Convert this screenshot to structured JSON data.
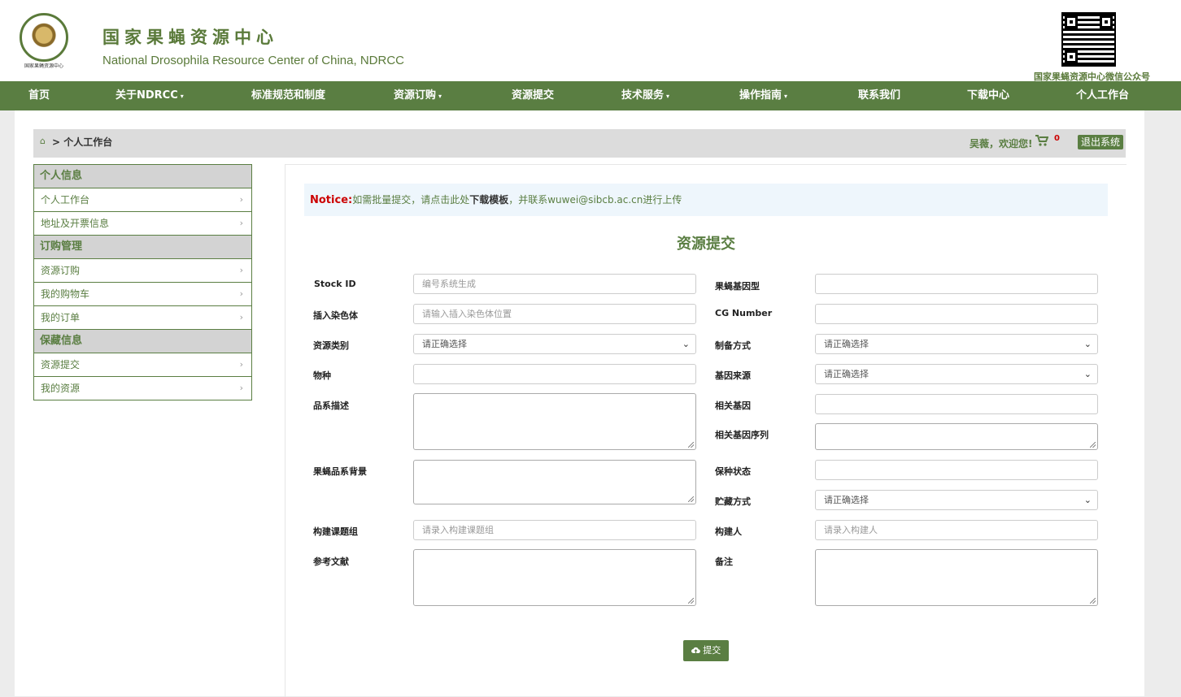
{
  "header": {
    "title_cn": "国家果蝇资源中心",
    "title_en": "National Drosophila Resource Center of China, NDRCC",
    "logo_caption": "国家果蝇资源中心",
    "qr_caption": "国家果蝇资源中心微信公众号"
  },
  "nav": {
    "items": [
      {
        "label": "首页"
      },
      {
        "label": "关于NDRCC",
        "dropdown": true
      },
      {
        "label": "标准规范和制度"
      },
      {
        "label": "资源订购",
        "dropdown": true
      },
      {
        "label": "资源提交"
      },
      {
        "label": "技术服务",
        "dropdown": true
      },
      {
        "label": "操作指南",
        "dropdown": true
      },
      {
        "label": "联系我们"
      },
      {
        "label": "下载中心"
      },
      {
        "label": "个人工作台"
      }
    ],
    "caret": "▾"
  },
  "breadcrumb": {
    "home_icon": "home-icon",
    "separator_text": ">",
    "current": "个人工作台",
    "welcome": "吴薇，欢迎您!",
    "cart_count": "0",
    "logout": "退出系统"
  },
  "sidebar": {
    "groups": [
      {
        "title": "个人信息",
        "items": [
          "个人工作台",
          "地址及开票信息"
        ]
      },
      {
        "title": "订购管理",
        "items": [
          "资源订购",
          "我的购物车",
          "我的订单"
        ]
      },
      {
        "title": "保藏信息",
        "items": [
          "资源提交",
          "我的资源"
        ]
      }
    ],
    "chevron": "›"
  },
  "notice": {
    "label": "Notice:",
    "text1": "如需批量提交，请点击此处",
    "link": "下载模板",
    "text2": "，并联系wuwei@sibcb.ac.cn进行上传"
  },
  "form": {
    "title": "资源提交",
    "stock_id": {
      "label": "Stock ID",
      "placeholder": "编号系统生成"
    },
    "genotype": {
      "label": "果蝇基因型",
      "value": ""
    },
    "chromosome": {
      "label": "插入染色体",
      "placeholder": "请输入插入染色体位置"
    },
    "cg_number": {
      "label": "CG Number",
      "value": ""
    },
    "category": {
      "label": "资源类别",
      "selected": "请正确选择"
    },
    "prep_method": {
      "label": "制备方式",
      "selected": "请正确选择"
    },
    "species": {
      "label": "物种",
      "value": ""
    },
    "gene_source": {
      "label": "基因来源",
      "selected": "请正确选择"
    },
    "strain_desc": {
      "label": "品系描述"
    },
    "related_gene": {
      "label": "相关基因",
      "value": ""
    },
    "related_seq": {
      "label": "相关基因序列"
    },
    "strain_background": {
      "label": "果蝇品系背景"
    },
    "preservation_state": {
      "label": "保种状态",
      "value": ""
    },
    "storage_method": {
      "label": "贮藏方式",
      "selected": "请正确选择"
    },
    "lab_group": {
      "label": "构建课题组",
      "placeholder": "请录入构建课题组"
    },
    "builder": {
      "label": "构建人",
      "placeholder": "请录入构建人"
    },
    "references": {
      "label": "参考文献"
    },
    "remarks": {
      "label": "备注"
    },
    "submit_label": "提交",
    "select_arrow": "⌄"
  }
}
